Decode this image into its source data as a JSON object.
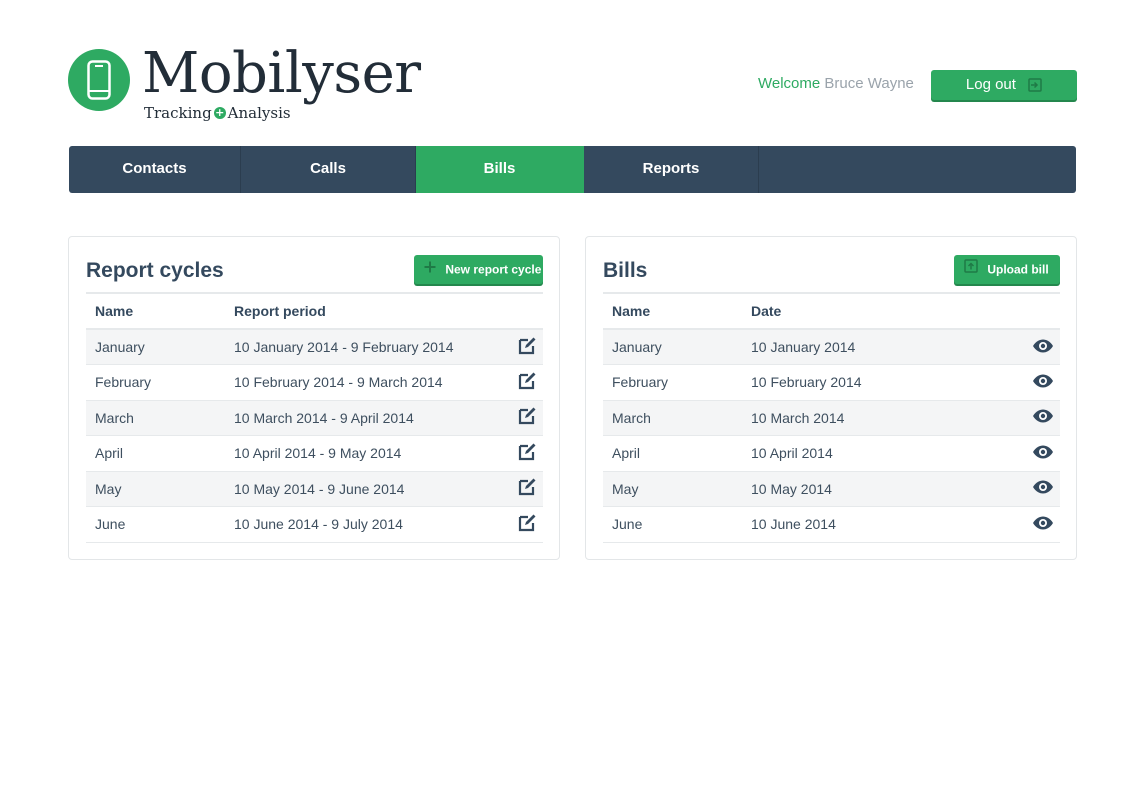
{
  "brand": {
    "name": "Mobilyser",
    "tagline_left": "Tracking",
    "tagline_plus": "+",
    "tagline_right": "Analysis",
    "color": "#2eaa62"
  },
  "user": {
    "welcome": "Welcome",
    "name": "Bruce Wayne"
  },
  "header": {
    "logout_label": "Log out"
  },
  "nav": {
    "items": [
      {
        "label": "Contacts",
        "active": false
      },
      {
        "label": "Calls",
        "active": false
      },
      {
        "label": "Bills",
        "active": true
      },
      {
        "label": "Reports",
        "active": false
      }
    ]
  },
  "report_cycles": {
    "title": "Report cycles",
    "button_label": "New report cycle",
    "columns": [
      "Name",
      "Report period"
    ],
    "rows": [
      {
        "name": "January",
        "period": "10 January 2014 - 9 February 2014"
      },
      {
        "name": "February",
        "period": "10 February 2014 - 9 March 2014"
      },
      {
        "name": "March",
        "period": "10 March 2014 - 9 April 2014"
      },
      {
        "name": "April",
        "period": "10 April 2014 - 9 May 2014"
      },
      {
        "name": "May",
        "period": "10 May 2014 - 9 June 2014"
      },
      {
        "name": "June",
        "period": "10 June 2014 - 9 July 2014"
      }
    ],
    "row_action_icon": "edit-icon"
  },
  "bills": {
    "title": "Bills",
    "button_label": "Upload bill",
    "columns": [
      "Name",
      "Date"
    ],
    "rows": [
      {
        "name": "January",
        "date": "10 January 2014"
      },
      {
        "name": "February",
        "date": "10 February 2014"
      },
      {
        "name": "March",
        "date": "10 March 2014"
      },
      {
        "name": "April",
        "date": "10 April 2014"
      },
      {
        "name": "May",
        "date": "10 May 2014"
      },
      {
        "name": "June",
        "date": "10 June 2014"
      }
    ],
    "row_action_icon": "eye-icon"
  },
  "colors": {
    "accent": "#2eaa62",
    "nav_bg": "#34495e",
    "text": "#34495e"
  }
}
